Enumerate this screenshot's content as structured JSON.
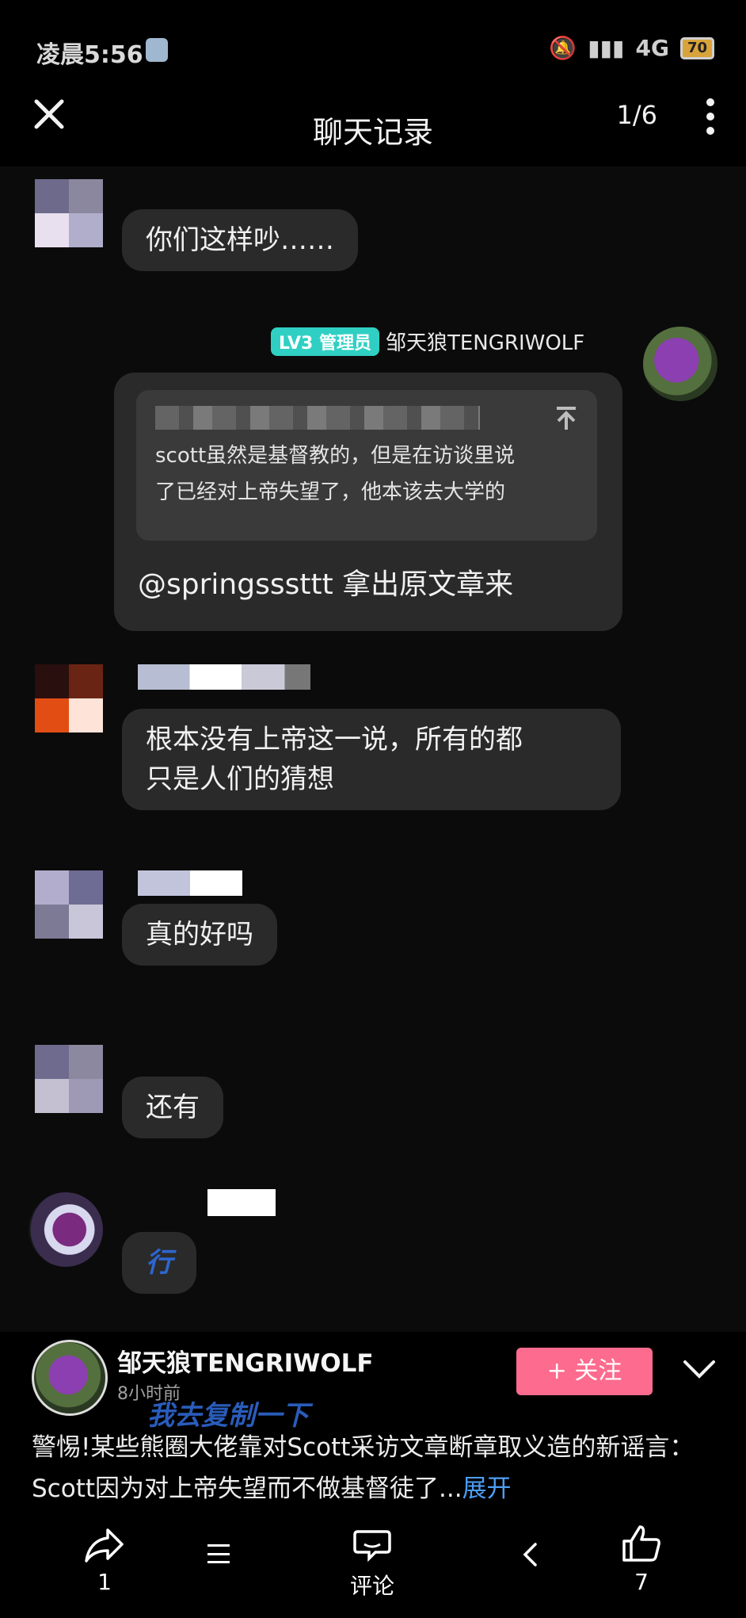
{
  "status_bar": {
    "time": "凌晨5:56",
    "network": "4G",
    "battery": "70"
  },
  "header": {
    "title": "聊天记录",
    "page_indicator": "1/6"
  },
  "messages": {
    "m1": {
      "text": "你们这样吵……"
    },
    "m2": {
      "badge": "LV3 管理员",
      "sender": "邹天狼TENGRIWOLF",
      "quote_line1": "scott虽然是基督教的，但是在访谈里说",
      "quote_line2": "了已经对上帝失望了，他本该去大学的",
      "text": "@springsssttt 拿出原文章来"
    },
    "m3": {
      "line1": "根本没有上帝这一说，所有的都",
      "line2": "只是人们的猜想"
    },
    "m4": {
      "text": "真的好吗"
    },
    "m5": {
      "text": "还有"
    },
    "m6": {
      "text": "行"
    }
  },
  "post": {
    "author": "邹天狼TENGRIWOLF",
    "time_ago": "8小时前",
    "overlay_text": "我去复制一下",
    "follow_label": "+ 关注",
    "description": "警惕!某些熊圈大佬靠对Scott采访文章断章取义造的新谣言：Scott因为对上帝失望而不做基督徒了...",
    "expand_label": "展开"
  },
  "bottom_bar": {
    "share_count": "1",
    "comment_label": "评论",
    "like_count": "7"
  },
  "colors": {
    "accent_pink": "#fd6b8e",
    "badge_teal": "#2fd0c3",
    "link_blue": "#4d9ef5"
  }
}
